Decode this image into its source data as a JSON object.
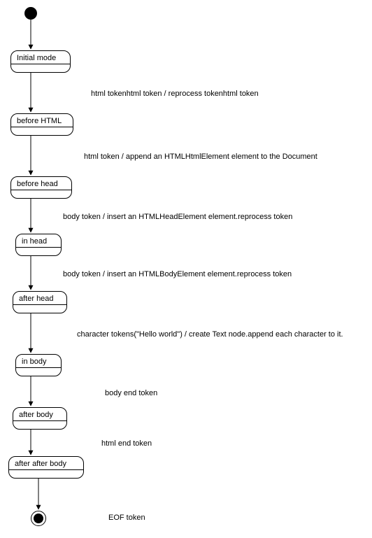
{
  "states": {
    "s0": "Initial mode",
    "s1": "before HTML",
    "s2": "before head",
    "s3": "in head",
    "s4": "after head",
    "s5": "in body",
    "s6": "after body",
    "s7": "after after body"
  },
  "transitions": {
    "t01": "html tokenhtml token / reprocess tokenhtml token",
    "t12": "html token / append an HTMLHtmlElement element to the Document",
    "t23": "body token / insert an HTMLHeadElement element.reprocess token",
    "t34": "body token / insert an HTMLBodyElement element.reprocess token",
    "t45": "character tokens(\"Hello world\") / create Text node.append each character to it.",
    "t56": "body end token",
    "t67": "html end token",
    "t7f": "EOF token"
  },
  "chart_data": {
    "type": "state-machine",
    "initial": "initial-pseudostate",
    "final": "final-pseudostate",
    "states": [
      "Initial mode",
      "before HTML",
      "before head",
      "in head",
      "after head",
      "in body",
      "after body",
      "after after body"
    ],
    "transitions": [
      {
        "from": "initial-pseudostate",
        "to": "Initial mode",
        "label": ""
      },
      {
        "from": "Initial mode",
        "to": "before HTML",
        "label": "html tokenhtml token / reprocess tokenhtml token"
      },
      {
        "from": "before HTML",
        "to": "before head",
        "label": "html token / append an HTMLHtmlElement element to the Document"
      },
      {
        "from": "before head",
        "to": "in head",
        "label": "body token / insert an HTMLHeadElement element.reprocess token"
      },
      {
        "from": "in head",
        "to": "after head",
        "label": "body token / insert an HTMLBodyElement element.reprocess token"
      },
      {
        "from": "after head",
        "to": "in body",
        "label": "character tokens(\"Hello world\") / create Text node.append each character to it."
      },
      {
        "from": "in body",
        "to": "after body",
        "label": "body end token"
      },
      {
        "from": "after body",
        "to": "after after body",
        "label": "html end token"
      },
      {
        "from": "after after body",
        "to": "final-pseudostate",
        "label": "EOF token"
      }
    ]
  }
}
